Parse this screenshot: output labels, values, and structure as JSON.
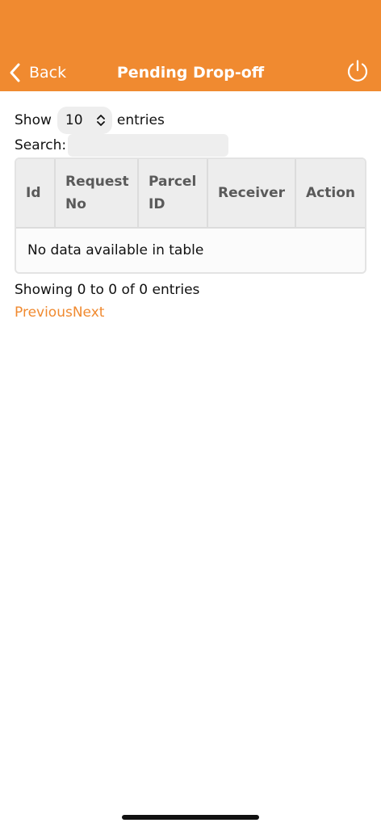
{
  "header": {
    "back_label": "Back",
    "title": "Pending Drop-off",
    "accent_color": "#f08a30"
  },
  "controls": {
    "show_label": "Show",
    "entries_value": "10",
    "entries_label": "entries",
    "search_label": "Search:",
    "search_value": ""
  },
  "table": {
    "columns": [
      "Id",
      "Request No",
      "Parcel ID",
      "Receiver",
      "Action"
    ],
    "empty_message": "No data available in table"
  },
  "footer": {
    "info": "Showing 0 to 0 of 0 entries",
    "previous": "Previous",
    "next": "Next"
  },
  "icons": {
    "back": "chevron-left-icon",
    "power": "power-icon",
    "select": "up-down-chevron-icon"
  }
}
